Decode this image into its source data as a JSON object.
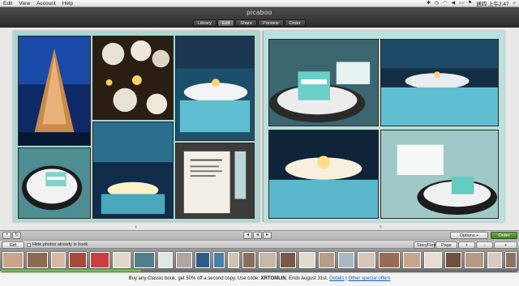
{
  "menubar": {
    "items": [
      "Edit",
      "View",
      "Account",
      "Help"
    ],
    "clock": "週四 上午2:47"
  },
  "app": {
    "title": "picaboo"
  },
  "tabs": [
    "Library",
    "Edit",
    "Share",
    "Preview",
    "Order"
  ],
  "pages": {
    "left_number": "4",
    "right_number": "5"
  },
  "controls": {
    "options_prices": "Options + Prices",
    "order_book": "Order Book"
  },
  "tray": {
    "get_photos": "Get Photos",
    "hide_used_label": "Hide photos already in book",
    "storyflow": "StoryFlow",
    "page_sorter": "Page Sorter",
    "add_page": "+ Page",
    "remove_page": "- Page",
    "add_caption": "+ Caption"
  },
  "upload_progress": 0.27,
  "promo": {
    "text_before": "Buy any Classic book, get 50% off a second copy. Use code: ",
    "code": "XRTOMLIN",
    "text_after": ". Ends August 31st. ",
    "details_link": "Details",
    "separator": " | ",
    "other_offers_link": "Other special offers"
  },
  "colors": {
    "spread_bg": "#a9d8d3",
    "order_green": "#4c8a30",
    "link_blue": "#1a5fb4"
  }
}
